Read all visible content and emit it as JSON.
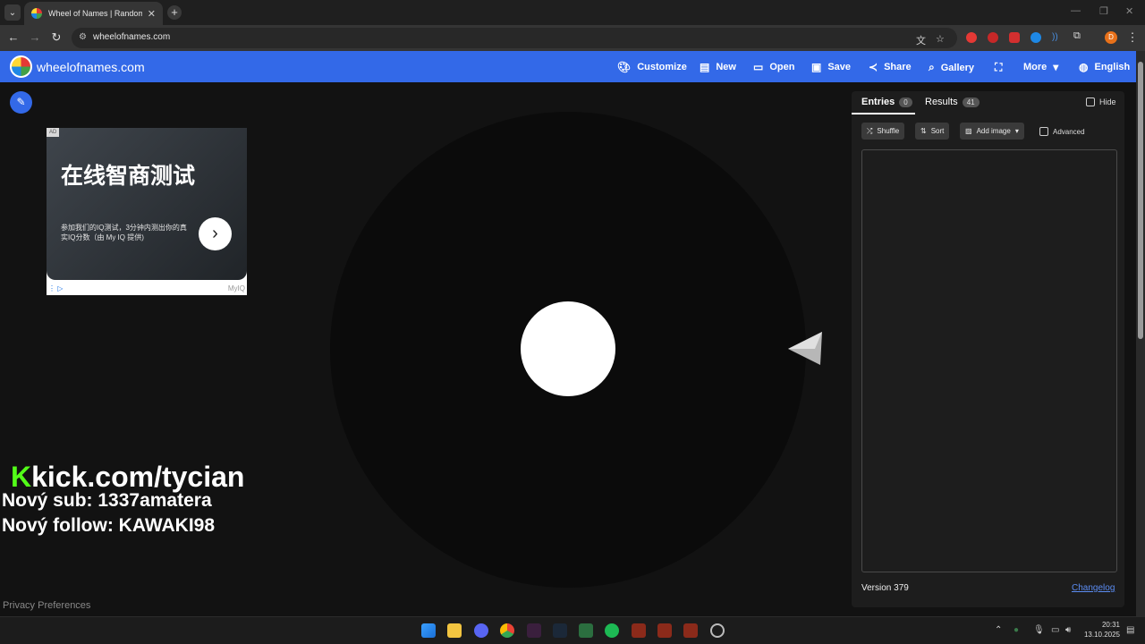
{
  "browser": {
    "tab_title": "Wheel of Names | Random name picker",
    "url": "wheelofnames.com"
  },
  "header": {
    "brand": "wheelofnames.com",
    "customize": "Customize",
    "new": "New",
    "open": "Open",
    "save": "Save",
    "share": "Share",
    "gallery": "Gallery",
    "more": "More",
    "language": "English"
  },
  "ad": {
    "badge": "AD",
    "title": "在线智商测试",
    "description": "参加我们的IQ测试，3分钟内测出你的真实IQ分数（由 My IQ 提供)",
    "brand": "MyIQ"
  },
  "overlay": {
    "kick_k": "K",
    "kick_url": "kick.com/tycian",
    "new_sub": "Nový sub: 1337amatera",
    "new_follow": "Nový follow: KAWAKI98"
  },
  "privacy": "Privacy Preferences",
  "panel": {
    "entries_label": "Entries",
    "entries_count": "0",
    "results_label": "Results",
    "results_count": "41",
    "hide_label": "Hide",
    "shuffle": "Shuffle",
    "sort": "Sort",
    "add_image": "Add image",
    "advanced": "Advanced",
    "version": "Version 379",
    "changelog": "Changelog"
  },
  "taskbar": {
    "time": "20:31",
    "date": "13.10.2025"
  },
  "colors": {
    "header_blue": "#3369e8",
    "kick_green": "#53fc18"
  }
}
